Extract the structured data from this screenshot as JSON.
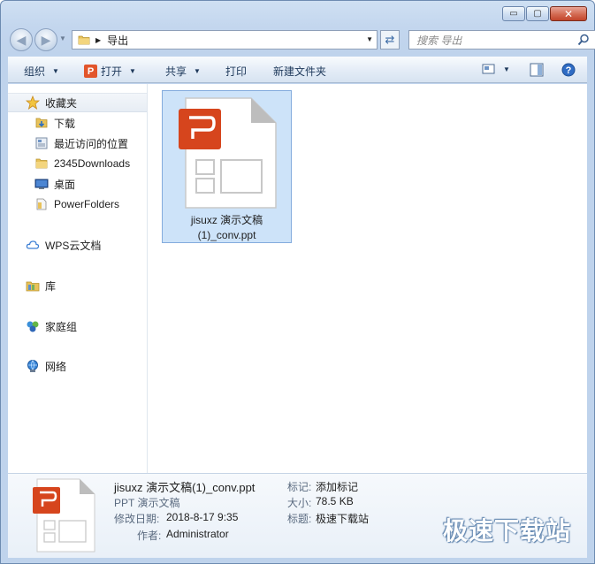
{
  "window": {
    "caption_buttons": {
      "minimize": "▭",
      "maximize": "▢",
      "close": "✕"
    }
  },
  "address": {
    "back_icon": "back-arrow-icon",
    "forward_icon": "forward-arrow-icon",
    "crumb": "导出",
    "search_placeholder": "搜索 导出"
  },
  "toolbar": {
    "organize": "组织",
    "open": "打开",
    "share": "共享",
    "print": "打印",
    "new_folder": "新建文件夹"
  },
  "sidebar": {
    "favorites_label": "收藏夹",
    "favorites": [
      {
        "label": "下载",
        "icon": "download-folder-icon"
      },
      {
        "label": "最近访问的位置",
        "icon": "recent-places-icon"
      },
      {
        "label": "2345Downloads",
        "icon": "folder-icon"
      },
      {
        "label": "桌面",
        "icon": "desktop-icon"
      },
      {
        "label": "PowerFolders",
        "icon": "folder-icon"
      }
    ],
    "wps_cloud": "WPS云文档",
    "libraries": "库",
    "homegroup": "家庭组",
    "network": "网络"
  },
  "files": [
    {
      "name_line1": "jisuxz 演示文稿",
      "name_line2": "(1)_conv.ppt",
      "icon": "ppt-file-icon",
      "selected": true
    }
  ],
  "details": {
    "title": "jisuxz 演示文稿(1)_conv.ppt",
    "type": "PPT 演示文稿",
    "modified_label": "修改日期:",
    "modified_value": "2018-8-17 9:35",
    "author_label": "作者:",
    "author_value": "Administrator",
    "tags_label": "标记:",
    "tags_value": "添加标记",
    "size_label": "大小:",
    "size_value": "78.5 KB",
    "title_label": "标题:",
    "title_value": "极速下载站"
  },
  "watermark": "极速下载站",
  "colors": {
    "accent_ppt": "#e2552b",
    "selection": "#cde3f9",
    "chrome": "#c3d6ee"
  }
}
